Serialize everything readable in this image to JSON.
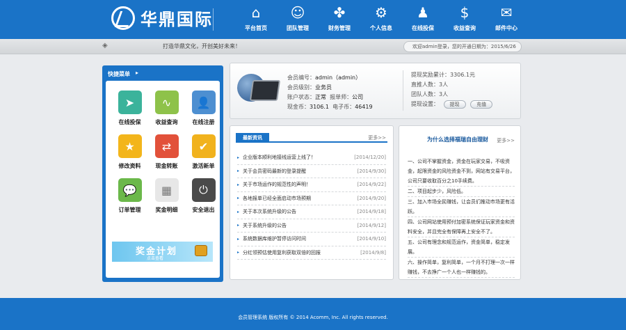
{
  "header": {
    "logo_text": "华鼎国际",
    "nav": [
      {
        "label": "平台首页",
        "icon": "home-icon",
        "glyph": "⌂"
      },
      {
        "label": "团队管理",
        "icon": "team-icon",
        "glyph": "☺"
      },
      {
        "label": "财务管理",
        "icon": "handshake-icon",
        "glyph": "✤"
      },
      {
        "label": "个人信息",
        "icon": "person-settings-icon",
        "glyph": "⚙"
      },
      {
        "label": "在线投保",
        "icon": "group-icon",
        "glyph": "♟"
      },
      {
        "label": "收益查询",
        "icon": "money-bag-icon",
        "glyph": "$"
      },
      {
        "label": "邮件中心",
        "icon": "mail-icon",
        "glyph": "✉"
      }
    ]
  },
  "infobar": {
    "marquee": "打造华鼎文化，开创美好未来！",
    "welcome": "欢迎admin登录，您的开通日期为：2015/6/26"
  },
  "quick_menu": {
    "title": "快捷菜单",
    "items": [
      {
        "label": "在线投保",
        "icon": "send-icon",
        "color": "#3bb39b",
        "glyph": "➤"
      },
      {
        "label": "收益查询",
        "icon": "line-chart-icon",
        "color": "#8ec24a",
        "glyph": "∿"
      },
      {
        "label": "在线注册",
        "icon": "user-icon",
        "color": "#4d8fd1",
        "glyph": "👤"
      },
      {
        "label": "修改资料",
        "icon": "star-icon",
        "color": "#f3b51b",
        "glyph": "★"
      },
      {
        "label": "现金转账",
        "icon": "transfer-icon",
        "color": "#e2513a",
        "glyph": "⇄"
      },
      {
        "label": "激活新单",
        "icon": "check-icon",
        "color": "#f1b21d",
        "glyph": "✔"
      },
      {
        "label": "订单管理",
        "icon": "chat-icon",
        "color": "#6bb84a",
        "glyph": "💬"
      },
      {
        "label": "奖金明细",
        "icon": "calendar-icon",
        "color": "#e7e7e7",
        "glyph": "▦"
      },
      {
        "label": "安全退出",
        "icon": "power-icon",
        "color": "#4a4a4a",
        "glyph": "⏻"
      }
    ],
    "banner_title": "奖金计划",
    "banner_sub": "点击查看"
  },
  "member": {
    "id_label": "会员编号：",
    "id_value": "admin（admin）",
    "level_label": "会员级别：",
    "level_value": "业务员",
    "status_label": "账户状态：",
    "status_value": "正常",
    "manager_label": "报单师：",
    "manager_value": "公司",
    "cash_label": "现金币：",
    "cash_value": "3106.1",
    "ecoin_label": "电子币：",
    "ecoin_value": "46419",
    "withdraw_total_label": "提现奖励累计：",
    "withdraw_total_value": "3306.1元",
    "direct_label": "直推人数：",
    "direct_value": "3人",
    "team_label": "团队人数：",
    "team_value": "3人",
    "withdraw_setting_label": "提现设置：",
    "btn_withdraw": "提现",
    "btn_recharge": "充值"
  },
  "news": {
    "tab": "最新资讯",
    "more": "更多>>",
    "items": [
      {
        "title": "企业版本顺利地接线运营上线了！",
        "date": "[2014/12/20]"
      },
      {
        "title": "关于会员密码最新的登录提醒",
        "date": "[2014/9/30]"
      },
      {
        "title": "关于市场运作的规范性的声明！",
        "date": "[2014/9/22]"
      },
      {
        "title": "各地报单已经全面启动市场预期",
        "date": "[2014/9/20]"
      },
      {
        "title": "关于本次系统升级的公告",
        "date": "[2014/9/18]"
      },
      {
        "title": "关于系统升级的公告",
        "date": "[2014/9/12]"
      },
      {
        "title": "系统数据库维护暂停访问时间",
        "date": "[2014/9/10]"
      },
      {
        "title": "分红领预估使用复利获取双倍的回报",
        "date": "[2014/9/8]"
      }
    ]
  },
  "why": {
    "title": "为什么选择福瑞自由理财",
    "more": "更多>>",
    "paragraphs": [
      "一、公司不掌握资金，资金在玩家交易，不吸资金，起限资金的风险资金不到，网站有交易平台，公司只要收取百分之10手续费。",
      "二、项目起步少，风险低。",
      "三、加入市场全民赚钱，让会员们推动市场更有活跃。",
      "四、公司网站使用预付加密系统保证玩家资金和资料安全，并且完全有保障再上安全不了。",
      "五、公司有理念和规范运作，资金简单，稳定发展。",
      "六、操作简单，复利简单，一个月不打理一次一样赚钱，不去挣广一个人也一样赚钱的。"
    ]
  },
  "footer": {
    "text": "会员管理系统  版权所有  © 2014 Acomm, Inc. All rights reserved."
  }
}
